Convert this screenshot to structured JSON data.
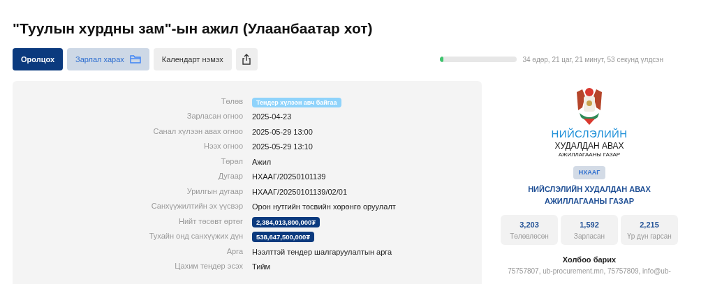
{
  "title": "\"Туулын хурдны зам\"-ын ажил (Улаанбаатар хот)",
  "actions": [
    {
      "kind": "primary",
      "label": "Оролцох"
    },
    {
      "kind": "soft",
      "label": "Зарлал харах"
    },
    {
      "kind": "plain",
      "label": "Календарт нэмэх"
    },
    {
      "kind": "share"
    }
  ],
  "countdown": {
    "level": 0.01,
    "text": "34 өдөр, 21 цаг, 21 минут, 53 секунд үлдсэн"
  },
  "details": [
    {
      "label": "Төлөв",
      "value": "Тендер хүлээн авч байгаа",
      "kind": "badge"
    },
    {
      "label": "Зарласан огноо",
      "value": "2025-04-23",
      "kind": "text"
    },
    {
      "label": "Санал хүлээн авах огноо",
      "value": "2025-05-29 13:00",
      "kind": "text"
    },
    {
      "label": "Нээх огноо",
      "value": "2025-05-29 13:10",
      "kind": "text"
    },
    {
      "label": "Төрөл",
      "value": "Ажил",
      "kind": "text"
    },
    {
      "label": "Дугаар",
      "value": "НХААГ/20250101139",
      "kind": "text"
    },
    {
      "label": "Урилгын дугаар",
      "value": "НХААГ/20250101139/02/01",
      "kind": "text"
    },
    {
      "label": "Санхүүжилтийн эх үүсвэр",
      "value": "Орон нутгийн төсвийн хөрөнгө оруулалт",
      "kind": "text"
    },
    {
      "label": "Нийт төсөвт өртөг",
      "value": "2,384,013,800,000₮",
      "kind": "amount"
    },
    {
      "label": "Тухайн онд санхүүжих дүн",
      "value": "538,647,500,000₮",
      "kind": "amount"
    },
    {
      "label": "Арга",
      "value": "Нээлттэй тендер шалгаруулалтын арга",
      "kind": "text"
    },
    {
      "label": "Цахим тендер эсэх",
      "value": "Тийм",
      "kind": "text"
    }
  ],
  "organization": {
    "logo_lines": [
      "НИЙСЛЭЛИЙН",
      "ХУДАЛДАН АВАХ",
      "АЖИЛЛАГААНЫ ГАЗАР"
    ],
    "badge": "НХААГ",
    "name": "НИЙСЛЭЛИЙН ХУДАЛДАН АВАХ АЖИЛЛАГААНЫ ГАЗАР",
    "stats": [
      {
        "value": "3,203",
        "label": "Төлөвлөсөн"
      },
      {
        "value": "1,592",
        "label": "Зарласан"
      },
      {
        "value": "2,215",
        "label": "Үр дүн гарсан"
      }
    ],
    "contact_title": "Холбоо барих",
    "contact": "75757807, ub-procurement.mn, 75757809, info@ub-"
  }
}
